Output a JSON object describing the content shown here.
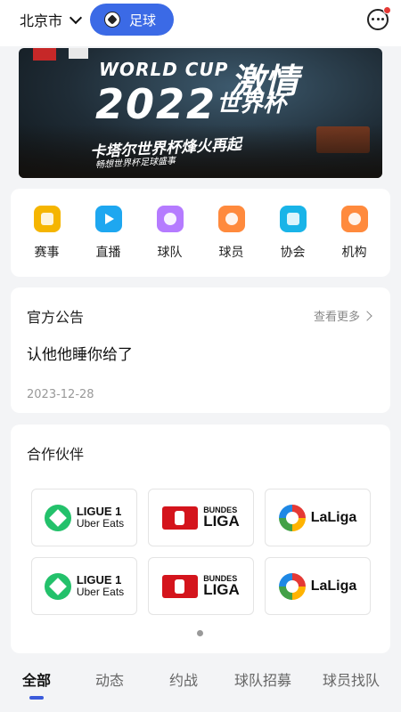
{
  "header": {
    "city": "北京市",
    "sport": "足球"
  },
  "banner": {
    "title_en": "WORLD CUP",
    "title_hot": "激情",
    "year": "2022",
    "title_cn": "世界杯",
    "subtitle": "卡塔尔世界杯烽火再起",
    "subtitle2": "畅想世界杯足球盛事"
  },
  "menu": {
    "items": [
      {
        "label": "赛事",
        "icon": "trophy-icon",
        "color": "#f5b500"
      },
      {
        "label": "直播",
        "icon": "play-icon",
        "color": "#1ea7f0"
      },
      {
        "label": "球队",
        "icon": "team-icon",
        "color": "#b57bff"
      },
      {
        "label": "球员",
        "icon": "player-medal-icon",
        "color": "#ff8a3d"
      },
      {
        "label": "协会",
        "icon": "association-icon",
        "color": "#19b4e8"
      },
      {
        "label": "机构",
        "icon": "organization-icon",
        "color": "#ff8a3d"
      }
    ]
  },
  "notice": {
    "title": "官方公告",
    "more": "查看更多",
    "body": "认他他睡你给了",
    "date": "2023-12-28"
  },
  "partners": {
    "title": "合作伙伴",
    "ligue1_line1": "LIGUE 1",
    "ligue1_line2": "Uber Eats",
    "bundes_line1": "BUNDES",
    "bundes_line2": "LIGA",
    "laliga": "LaLiga"
  },
  "tabs": [
    "全部",
    "动态",
    "约战",
    "球队招募",
    "球员找队"
  ]
}
